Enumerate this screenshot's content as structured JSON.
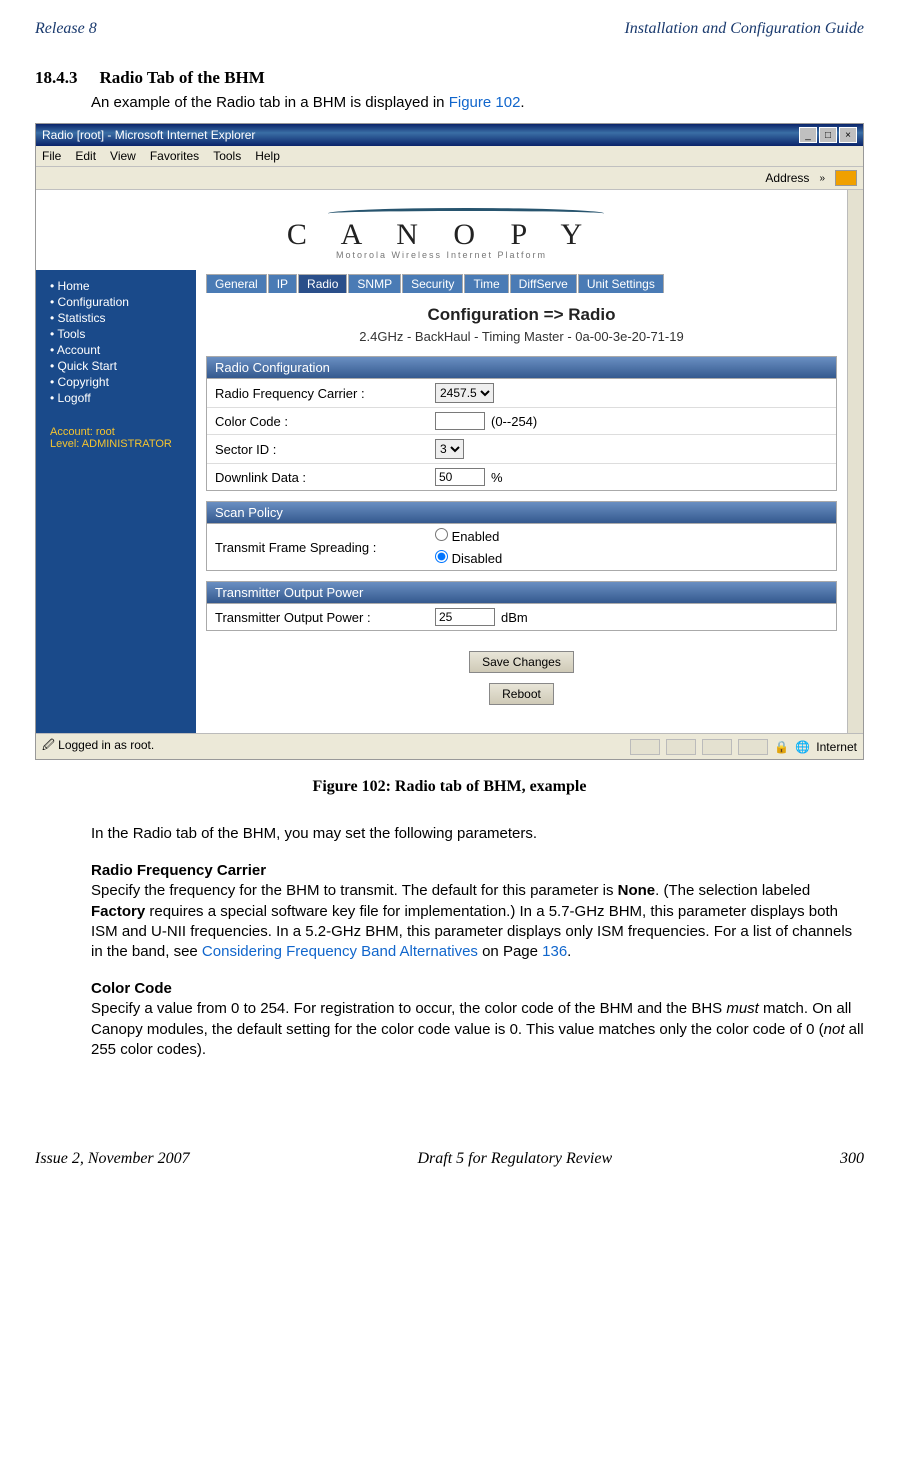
{
  "header": {
    "left": "Release 8",
    "right": "Installation and Configuration Guide"
  },
  "section": {
    "number": "18.4.3",
    "title": "Radio Tab of the BHM",
    "intro_pre": "An example of the Radio tab in a BHM is displayed in ",
    "intro_link": "Figure 102",
    "intro_post": "."
  },
  "browser": {
    "window_title": "Radio [root] - Microsoft Internet Explorer",
    "menus": [
      "File",
      "Edit",
      "View",
      "Favorites",
      "Tools",
      "Help"
    ],
    "address_label": "Address",
    "chevron": "»"
  },
  "canopy": {
    "brand": "C A N O P Y",
    "tagline": "Motorola Wireless Internet Platform"
  },
  "sidebar": {
    "items": [
      "Home",
      "Configuration",
      "Statistics",
      "Tools",
      "Account",
      "Quick Start",
      "Copyright",
      "Logoff"
    ],
    "account_line1": "Account: root",
    "account_line2": "Level: ADMINISTRATOR"
  },
  "tabs": [
    "General",
    "IP",
    "Radio",
    "SNMP",
    "Security",
    "Time",
    "DiffServe",
    "Unit Settings"
  ],
  "config": {
    "title": "Configuration => Radio",
    "subtitle": "2.4GHz - BackHaul - Timing Master - 0a-00-3e-20-71-19"
  },
  "panels": {
    "radio": {
      "header": "Radio Configuration",
      "freq_label": "Radio Frequency Carrier :",
      "freq_value": "2457.5",
      "color_label": "Color Code :",
      "color_value": "",
      "color_hint": "(0--254)",
      "sector_label": "Sector ID :",
      "sector_value": "3",
      "downlink_label": "Downlink Data :",
      "downlink_value": "50",
      "downlink_unit": "%"
    },
    "scan": {
      "header": "Scan Policy",
      "tfs_label": "Transmit Frame Spreading :",
      "opt_enabled": "Enabled",
      "opt_disabled": "Disabled"
    },
    "txpower": {
      "header": "Transmitter Output Power",
      "label": "Transmitter Output Power :",
      "value": "25",
      "unit": "dBm"
    }
  },
  "buttons": {
    "save": "Save Changes",
    "reboot": "Reboot"
  },
  "statusbar": {
    "left": "Logged in as root.",
    "zone": "Internet"
  },
  "caption": "Figure 102: Radio tab of BHM, example",
  "para1_intro": "In the Radio tab of the BHM, you may set the following parameters.",
  "rfc": {
    "heading": "Radio Frequency Carrier",
    "p1a": "Specify the frequency for the BHM to transmit. The default for this parameter is ",
    "p1b": "None",
    "p1c": ". (The selection labeled ",
    "p1d": "Factory",
    "p1e": " requires a special software key file for implementation.) In a 5.7-GHz BHM, this parameter displays both ISM and U-NII frequencies. In a 5.2-GHz BHM, this parameter displays only ISM frequencies. For a list of channels in the band, see ",
    "p1link": "Considering Frequency Band Alternatives",
    "p1f": " on Page ",
    "p1page": "136",
    "p1g": "."
  },
  "cc": {
    "heading": "Color Code",
    "p_a": "Specify a value from 0 to 254. For registration to occur, the color code of the BHM and the BHS ",
    "p_em": "must",
    "p_b": " match. On all Canopy modules, the default setting for the color code value is 0. This value matches only the color code of 0 (",
    "p_em2": "not",
    "p_c": " all 255 color codes)."
  },
  "footer": {
    "left": "Issue 2, November 2007",
    "center": "Draft 5 for Regulatory Review",
    "right": "300"
  }
}
